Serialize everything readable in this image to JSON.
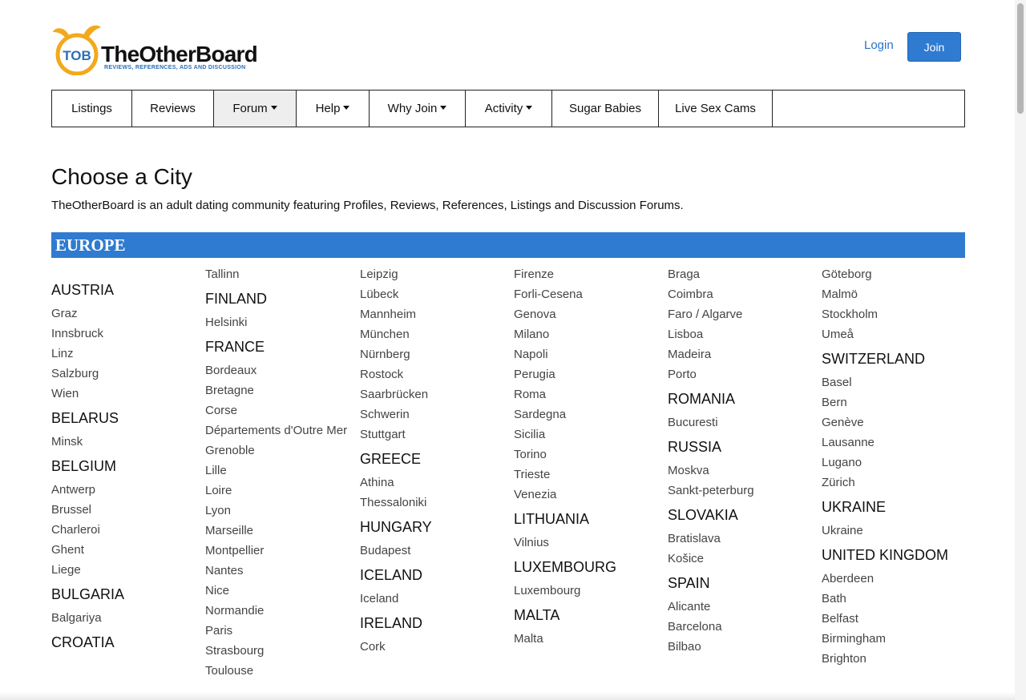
{
  "header": {
    "logo_text": "TheOtherBoard",
    "logo_badge": "TOB",
    "logo_tagline": "REVIEWS, REFERENCES, ADS AND DISCUSSION",
    "login_label": "Login",
    "join_label": "Join"
  },
  "nav": {
    "items": [
      {
        "label": "Listings"
      },
      {
        "label": "Reviews"
      },
      {
        "label": "Forum"
      },
      {
        "label": "Help"
      },
      {
        "label": "Why Join"
      },
      {
        "label": "Activity"
      },
      {
        "label": "Sugar Babies"
      },
      {
        "label": "Live Sex Cams"
      }
    ]
  },
  "page": {
    "title": "Choose a City",
    "intro": "TheOtherBoard is an adult dating community featuring Profiles, Reviews, References, Listings and Discussion Forums."
  },
  "region": {
    "title": "EUROPE",
    "columns": [
      [
        {
          "type": "country",
          "text": "AUSTRIA"
        },
        {
          "type": "city",
          "text": "Graz"
        },
        {
          "type": "city",
          "text": "Innsbruck"
        },
        {
          "type": "city",
          "text": "Linz"
        },
        {
          "type": "city",
          "text": "Salzburg"
        },
        {
          "type": "city",
          "text": "Wien"
        },
        {
          "type": "country",
          "text": "BELARUS"
        },
        {
          "type": "city",
          "text": "Minsk"
        },
        {
          "type": "country",
          "text": "BELGIUM"
        },
        {
          "type": "city",
          "text": "Antwerp"
        },
        {
          "type": "city",
          "text": "Brussel"
        },
        {
          "type": "city",
          "text": "Charleroi"
        },
        {
          "type": "city",
          "text": "Ghent"
        },
        {
          "type": "city",
          "text": "Liege"
        },
        {
          "type": "country",
          "text": "BULGARIA"
        },
        {
          "type": "city",
          "text": "Balgariya"
        },
        {
          "type": "country",
          "text": "CROATIA"
        }
      ],
      [
        {
          "type": "city",
          "text": "Tallinn"
        },
        {
          "type": "country",
          "text": "FINLAND"
        },
        {
          "type": "city",
          "text": "Helsinki"
        },
        {
          "type": "country",
          "text": "FRANCE"
        },
        {
          "type": "city",
          "text": "Bordeaux"
        },
        {
          "type": "city",
          "text": "Bretagne"
        },
        {
          "type": "city",
          "text": "Corse"
        },
        {
          "type": "city",
          "text": "Départements d'Outre Mer"
        },
        {
          "type": "city",
          "text": "Grenoble"
        },
        {
          "type": "city",
          "text": "Lille"
        },
        {
          "type": "city",
          "text": "Loire"
        },
        {
          "type": "city",
          "text": "Lyon"
        },
        {
          "type": "city",
          "text": "Marseille"
        },
        {
          "type": "city",
          "text": "Montpellier"
        },
        {
          "type": "city",
          "text": "Nantes"
        },
        {
          "type": "city",
          "text": "Nice"
        },
        {
          "type": "city",
          "text": "Normandie"
        },
        {
          "type": "city",
          "text": "Paris"
        },
        {
          "type": "city",
          "text": "Strasbourg"
        },
        {
          "type": "city",
          "text": "Toulouse"
        }
      ],
      [
        {
          "type": "city",
          "text": "Leipzig"
        },
        {
          "type": "city",
          "text": "Lübeck"
        },
        {
          "type": "city",
          "text": "Mannheim"
        },
        {
          "type": "city",
          "text": "München"
        },
        {
          "type": "city",
          "text": "Nürnberg"
        },
        {
          "type": "city",
          "text": "Rostock"
        },
        {
          "type": "city",
          "text": "Saarbrücken"
        },
        {
          "type": "city",
          "text": "Schwerin"
        },
        {
          "type": "city",
          "text": "Stuttgart"
        },
        {
          "type": "country",
          "text": "GREECE"
        },
        {
          "type": "city",
          "text": "Athina"
        },
        {
          "type": "city",
          "text": "Thessaloniki"
        },
        {
          "type": "country",
          "text": "HUNGARY"
        },
        {
          "type": "city",
          "text": "Budapest"
        },
        {
          "type": "country",
          "text": "ICELAND"
        },
        {
          "type": "city",
          "text": "Iceland"
        },
        {
          "type": "country",
          "text": "IRELAND"
        },
        {
          "type": "city",
          "text": "Cork"
        }
      ],
      [
        {
          "type": "city",
          "text": "Firenze"
        },
        {
          "type": "city",
          "text": "Forli-Cesena"
        },
        {
          "type": "city",
          "text": "Genova"
        },
        {
          "type": "city",
          "text": "Milano"
        },
        {
          "type": "city",
          "text": "Napoli"
        },
        {
          "type": "city",
          "text": "Perugia"
        },
        {
          "type": "city",
          "text": "Roma"
        },
        {
          "type": "city",
          "text": "Sardegna"
        },
        {
          "type": "city",
          "text": "Sicilia"
        },
        {
          "type": "city",
          "text": "Torino"
        },
        {
          "type": "city",
          "text": "Trieste"
        },
        {
          "type": "city",
          "text": "Venezia"
        },
        {
          "type": "country",
          "text": "LITHUANIA"
        },
        {
          "type": "city",
          "text": "Vilnius"
        },
        {
          "type": "country",
          "text": "LUXEMBOURG"
        },
        {
          "type": "city",
          "text": "Luxembourg"
        },
        {
          "type": "country",
          "text": "MALTA"
        },
        {
          "type": "city",
          "text": "Malta"
        }
      ],
      [
        {
          "type": "city",
          "text": "Braga"
        },
        {
          "type": "city",
          "text": "Coimbra"
        },
        {
          "type": "city",
          "text": "Faro / Algarve"
        },
        {
          "type": "city",
          "text": "Lisboa"
        },
        {
          "type": "city",
          "text": "Madeira"
        },
        {
          "type": "city",
          "text": "Porto"
        },
        {
          "type": "country",
          "text": "ROMANIA"
        },
        {
          "type": "city",
          "text": "Bucuresti"
        },
        {
          "type": "country",
          "text": "RUSSIA"
        },
        {
          "type": "city",
          "text": "Moskva"
        },
        {
          "type": "city",
          "text": "Sankt-peterburg"
        },
        {
          "type": "country",
          "text": "SLOVAKIA"
        },
        {
          "type": "city",
          "text": "Bratislava"
        },
        {
          "type": "city",
          "text": "Košice"
        },
        {
          "type": "country",
          "text": "SPAIN"
        },
        {
          "type": "city",
          "text": "Alicante"
        },
        {
          "type": "city",
          "text": "Barcelona"
        },
        {
          "type": "city",
          "text": "Bilbao"
        }
      ],
      [
        {
          "type": "city",
          "text": "Göteborg"
        },
        {
          "type": "city",
          "text": "Malmö"
        },
        {
          "type": "city",
          "text": "Stockholm"
        },
        {
          "type": "city",
          "text": "Umeå"
        },
        {
          "type": "country",
          "text": "SWITZERLAND"
        },
        {
          "type": "city",
          "text": "Basel"
        },
        {
          "type": "city",
          "text": "Bern"
        },
        {
          "type": "city",
          "text": "Genève"
        },
        {
          "type": "city",
          "text": "Lausanne"
        },
        {
          "type": "city",
          "text": "Lugano"
        },
        {
          "type": "city",
          "text": "Zürich"
        },
        {
          "type": "country",
          "text": "UKRAINE"
        },
        {
          "type": "city",
          "text": "Ukraine"
        },
        {
          "type": "country",
          "text": "UNITED KINGDOM"
        },
        {
          "type": "city",
          "text": "Aberdeen"
        },
        {
          "type": "city",
          "text": "Bath"
        },
        {
          "type": "city",
          "text": "Belfast"
        },
        {
          "type": "city",
          "text": "Birmingham"
        },
        {
          "type": "city",
          "text": "Brighton"
        }
      ]
    ]
  },
  "colors": {
    "accent": "#2f7bd1",
    "link": "#444444",
    "login": "#2a73c9",
    "logo_orange": "#f2a91c"
  }
}
